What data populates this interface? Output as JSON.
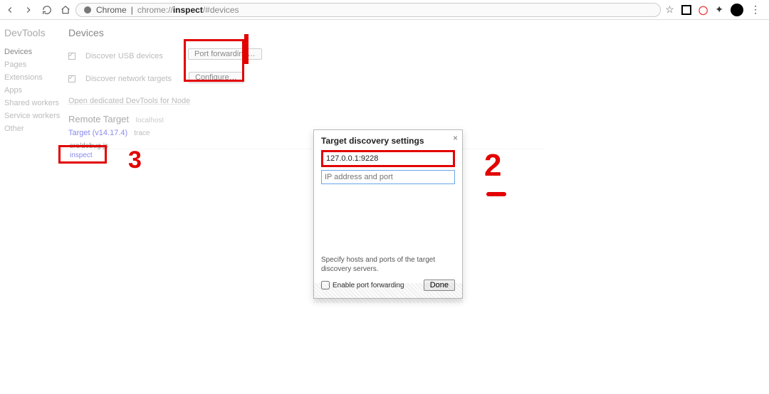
{
  "browser": {
    "app_label": "Chrome",
    "url_plain": "chrome://",
    "url_bold": "inspect",
    "url_rest": "/#devices"
  },
  "sidebar": {
    "title": "DevTools",
    "items": [
      "Devices",
      "Pages",
      "Extensions",
      "Apps",
      "Shared workers",
      "Service workers",
      "Other"
    ]
  },
  "main": {
    "title": "Devices",
    "discover_usb": "Discover USB devices",
    "port_forwarding_btn": "Port forwarding…",
    "discover_net": "Discover network targets",
    "configure_btn": "Configure…",
    "dedicated_link": "Open dedicated DevTools for Node",
    "remote_header": "Remote Target",
    "remote_host": "localhost",
    "target_label": "Target (v14.17.4)",
    "target_trace": "trace",
    "target_detail_top": "src/debug.js",
    "target_detail_inspect": "inspect"
  },
  "dialog": {
    "title": "Target discovery settings",
    "entry1": "127.0.0.1:9228",
    "input_placeholder": "IP address and port",
    "help": "Specify hosts and ports of the target discovery servers.",
    "enable_pf": "Enable port forwarding",
    "done": "Done"
  },
  "annotations": {
    "label2": "2",
    "label3": "3"
  }
}
